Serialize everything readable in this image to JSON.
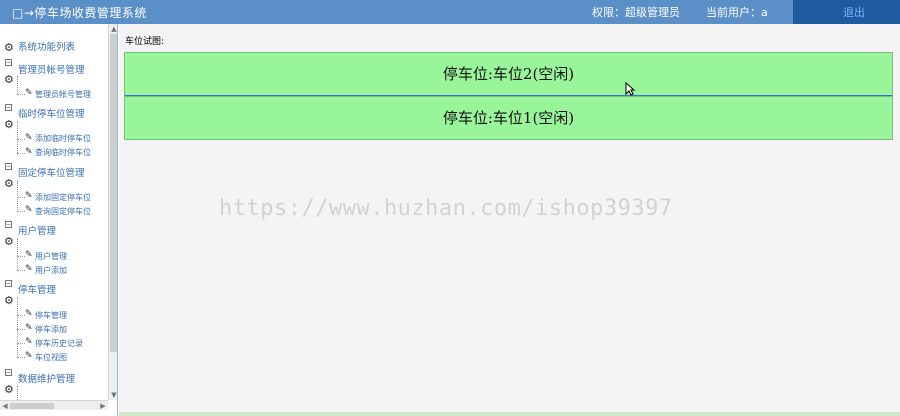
{
  "header": {
    "title": "□→停车场收费管理系统",
    "permission": "权限：超级管理员",
    "current_user": "当前用户：a",
    "logout": "退出"
  },
  "sidebar": {
    "root": "系统功能列表",
    "groups": [
      {
        "label": "管理员帐号管理",
        "items": [
          "管理员帐号管理"
        ]
      },
      {
        "label": "临时停车位管理",
        "items": [
          "添加临时停车位",
          "查询临时停车位"
        ]
      },
      {
        "label": "固定停车位管理",
        "items": [
          "添加固定停车位",
          "查询固定停车位"
        ]
      },
      {
        "label": "用户管理",
        "items": [
          "用户管理",
          "用户添加"
        ]
      },
      {
        "label": "停车管理",
        "items": [
          "停车管理",
          "停车添加",
          "停车历史记录",
          "车位视图"
        ]
      },
      {
        "label": "数据维护管理",
        "items": []
      }
    ]
  },
  "main": {
    "caption": "车位试图:",
    "slots": [
      "停车位:车位2(空闲)",
      "停车位:车位1(空闲)"
    ],
    "slot_color": "#99f59a"
  },
  "watermark": "https://www.huzhan.com/ishop39397"
}
